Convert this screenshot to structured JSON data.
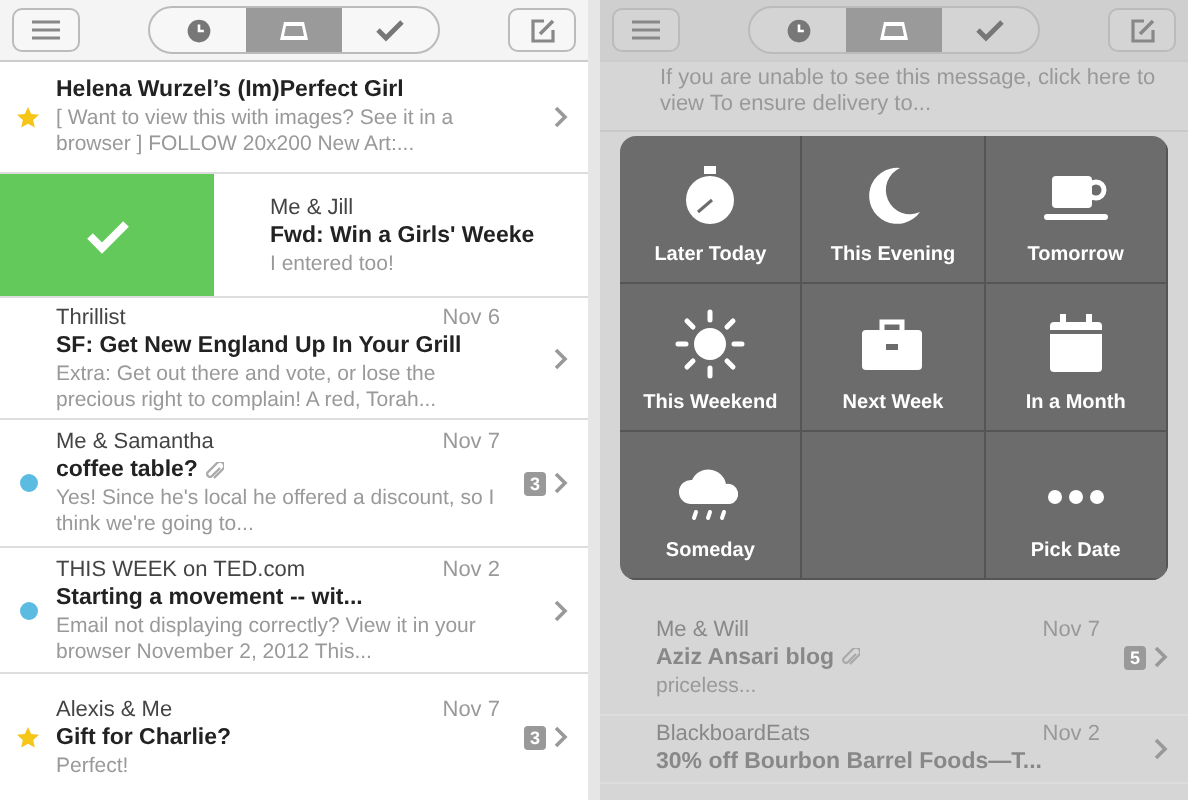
{
  "screens": [
    {
      "dimmed": false,
      "header": {
        "segments": [
          {
            "kind": "clock",
            "selected": false
          },
          {
            "kind": "inbox",
            "selected": true
          },
          {
            "kind": "check",
            "selected": false
          }
        ]
      },
      "rows": [
        {
          "kind": "email",
          "subject": "Helena Wurzel’s (Im)Perfect Girl",
          "preview": "[ Want to view this with images? See it in a browser ] FOLLOW 20x200 New Art:...",
          "starred": true,
          "unread": false,
          "attachment": false
        },
        {
          "kind": "swiped",
          "sender": "Me & Jill",
          "subject": "Fwd: Win a Girls' Weeke",
          "preview": "I entered too!"
        },
        {
          "kind": "email",
          "sender": "Thrillist",
          "date": "Nov 6",
          "subject": "SF: Get New England Up In Your Grill",
          "preview": "Extra: Get out there and vote, or lose the precious right to complain! A red, Torah...",
          "starred": false,
          "unread": false,
          "attachment": false
        },
        {
          "kind": "email",
          "sender": "Me & Samantha",
          "date": "Nov 7",
          "subject": "coffee table?",
          "preview": "Yes! Since he's local he offered a discount, so I think we're going to...",
          "starred": false,
          "unread": true,
          "color": "#5bbbe0",
          "attachment": true,
          "count": "3"
        },
        {
          "kind": "email",
          "sender": "THIS WEEK on TED.com",
          "date": "Nov 2",
          "subject": "Starting a movement -- wit...",
          "preview": "Email not displaying correctly? View it in your browser November 2, 2012 This...",
          "starred": false,
          "unread": true,
          "color": "#5bbbe0",
          "attachment": false
        },
        {
          "kind": "email",
          "sender": "Alexis & Me",
          "date": "Nov 7",
          "subject": "Gift for Charlie?",
          "preview": "Perfect!",
          "starred": true,
          "unread": false,
          "attachment": false,
          "count": "3"
        }
      ]
    },
    {
      "dimmed": true,
      "header": {
        "segments": [
          {
            "kind": "clock",
            "selected": false
          },
          {
            "kind": "inbox",
            "selected": true
          },
          {
            "kind": "check",
            "selected": false
          }
        ]
      },
      "top_preview": "If you are unable to see this message, click here to view To ensure delivery to...",
      "snooze": [
        {
          "kind": "stopwatch",
          "label": "Later Today"
        },
        {
          "kind": "moon",
          "label": "This Evening"
        },
        {
          "kind": "cup",
          "label": "Tomorrow"
        },
        {
          "kind": "sun",
          "label": "This Weekend"
        },
        {
          "kind": "briefcase",
          "label": "Next Week"
        },
        {
          "kind": "calendar",
          "label": "In a Month"
        },
        {
          "kind": "cloud",
          "label": "Someday"
        },
        {
          "kind": "empty"
        },
        {
          "kind": "dots",
          "label": "Pick Date"
        }
      ],
      "rows": [
        {
          "kind": "email",
          "sender": "Me & Will",
          "date": "Nov 7",
          "subject": "Aziz Ansari blog",
          "preview": "priceless...",
          "starred": false,
          "unread": false,
          "attachment": true,
          "count": "5"
        },
        {
          "kind": "email",
          "sender": "BlackboardEats",
          "date": "Nov 2",
          "subject": "30% off Bourbon Barrel Foods—T...",
          "starred": false,
          "unread": false,
          "attachment": false
        }
      ]
    }
  ]
}
